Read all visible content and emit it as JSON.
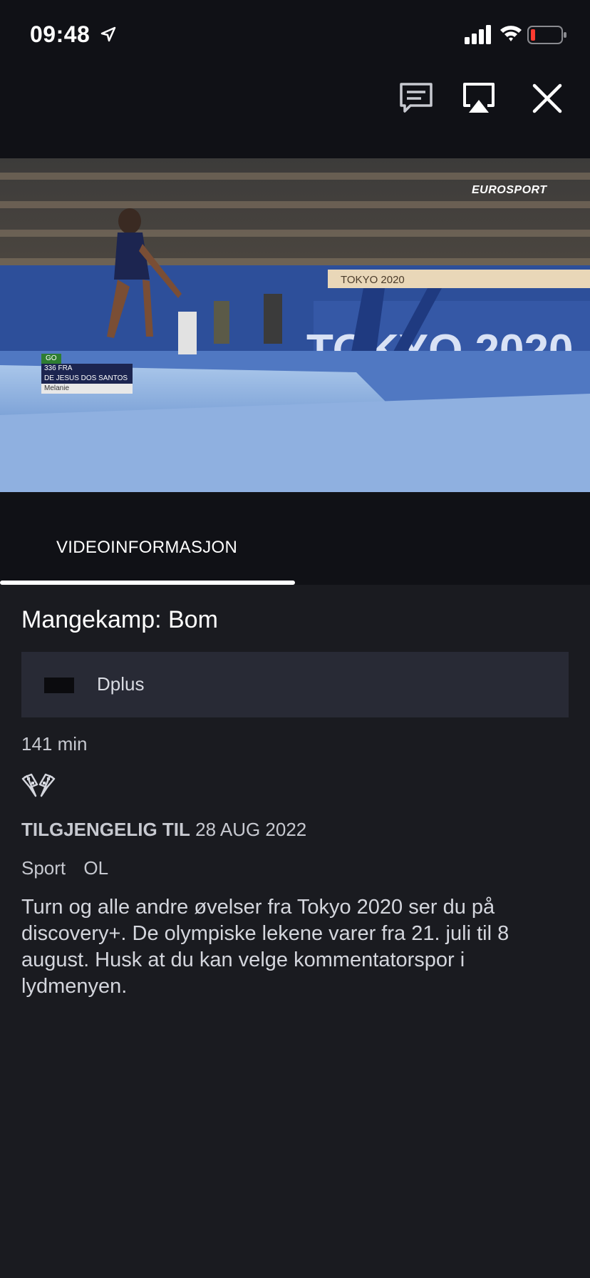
{
  "status_bar": {
    "time": "09:48"
  },
  "player_controls": {
    "subtitles_icon": "speech-bubble-lines-icon",
    "airplay_icon": "airplay-icon",
    "close_icon": "close-icon"
  },
  "video": {
    "channel_logo": "EUROSPORT",
    "arena_banner": "TOKYO 2020",
    "scoreboard": {
      "status": "GO",
      "bib": "336 FRA",
      "athlete": "DE JESUS DOS SANTOS",
      "first_name": "Melanie"
    }
  },
  "tabs": [
    {
      "label": "VIDEOINFORMASJON"
    }
  ],
  "details": {
    "title": "Mangekamp: Bom",
    "provider": "Dplus",
    "duration": "141 min",
    "category_icon": "checkered-flags-icon",
    "availability_label": "TILGJENGELIG TIL",
    "availability_date": "28 AUG 2022",
    "tags": [
      "Sport",
      "OL"
    ],
    "description": "Turn og alle andre øvelser fra Tokyo 2020 ser du på discovery+. De olympiske lekene varer fra 21. juli til 8 august. Husk at du kan velge kommentatorspor i lydmenyen."
  },
  "colors": {
    "background": "#1a1b20",
    "header": "#101116",
    "card": "#282a35",
    "text_secondary": "#c7c9d0"
  }
}
